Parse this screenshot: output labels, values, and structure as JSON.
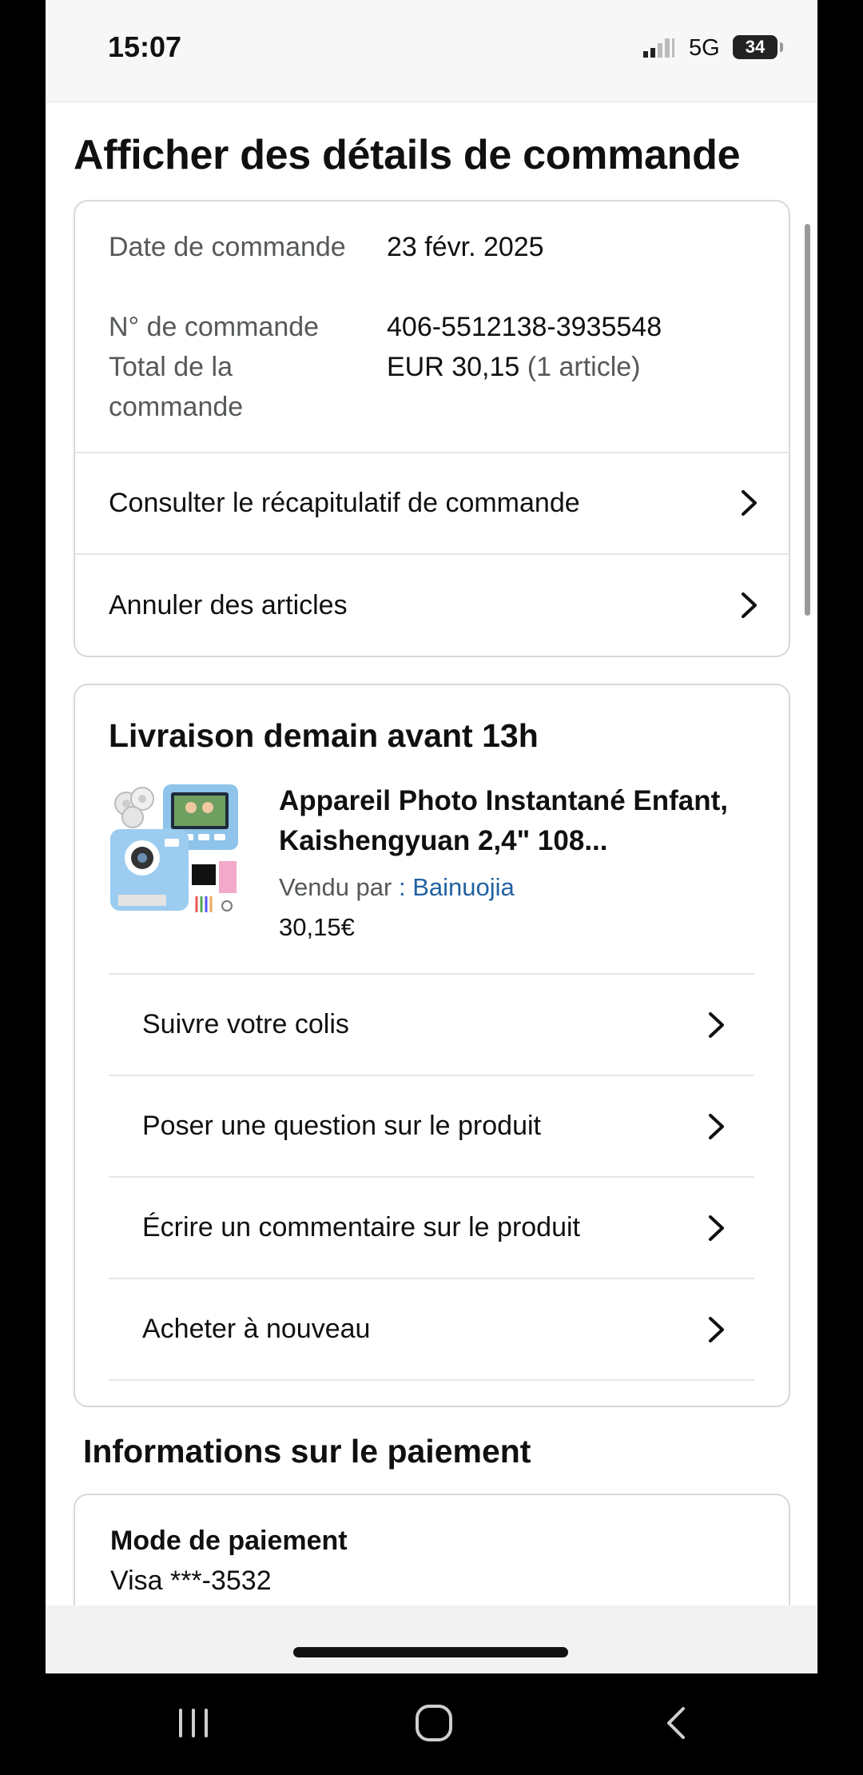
{
  "status_bar": {
    "time": "15:07",
    "network": "5G",
    "battery": "34"
  },
  "page": {
    "title": "Afficher des détails de commande"
  },
  "order_summary": {
    "date_label": "Date de commande",
    "date_value": "23 févr. 2025",
    "number_label": "N° de commande",
    "number_value": "406-5512138-3935548",
    "total_label": "Total de la commande",
    "total_value": "EUR 30,15",
    "total_items": "(1 article)",
    "links": [
      {
        "label": "Consulter le récapitulatif de commande"
      },
      {
        "label": "Annuler des articles"
      }
    ]
  },
  "delivery": {
    "title": "Livraison demain avant 13h",
    "product": {
      "title": "Appareil Photo Instantané Enfant, Kaishengyuan 2,4\" 108...",
      "sold_by_label": "Vendu par",
      "seller": ": Bainuojia",
      "price": "30,15€"
    },
    "actions": [
      {
        "label": "Suivre votre colis"
      },
      {
        "label": "Poser une question sur le produit"
      },
      {
        "label": "Écrire un commentaire sur le produit"
      },
      {
        "label": "Acheter à nouveau"
      }
    ]
  },
  "payment": {
    "heading": "Informations sur le paiement",
    "method_label": "Mode de paiement",
    "method_value": "Visa ***-3532"
  },
  "colors": {
    "link_blue": "#2162a1",
    "text_primary": "#0f1111",
    "text_secondary": "#565959",
    "card_border": "#d5d9d9"
  },
  "icons": {
    "row_chevron": "chevron-right-icon",
    "nav_recent": "recent-apps-icon",
    "nav_home": "home-icon",
    "nav_back": "back-icon"
  }
}
